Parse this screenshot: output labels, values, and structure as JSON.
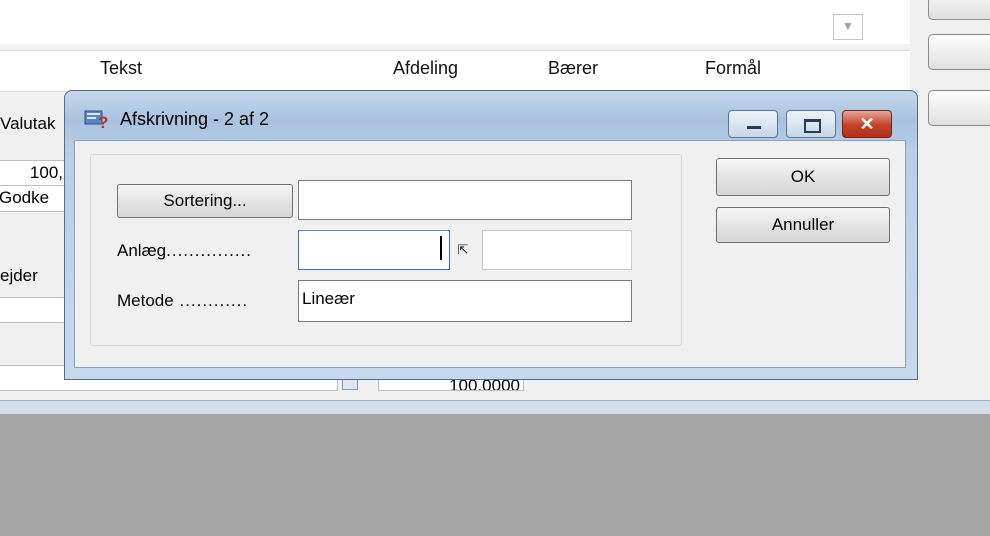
{
  "background": {
    "columns": [
      "Tekst",
      "Afdeling",
      "Bærer",
      "Formål"
    ],
    "left_cells": [
      "Valutak",
      "100,",
      "Godke",
      "ejder"
    ],
    "bottom_value": "100,0000",
    "dropdown_glyph": "▼"
  },
  "dialog": {
    "title": "Afskrivning - 2 af 2",
    "buttons": {
      "ok": "OK",
      "cancel": "Annuller",
      "sort": "Sortering..."
    },
    "fields": {
      "sort_value": "",
      "anlaeg_label": "Anlæg",
      "anlaeg_value": "",
      "anlaeg_extra": "",
      "metode_label": "Metode",
      "metode_value": "Lineær"
    },
    "lookup_glyph": "⇱"
  }
}
